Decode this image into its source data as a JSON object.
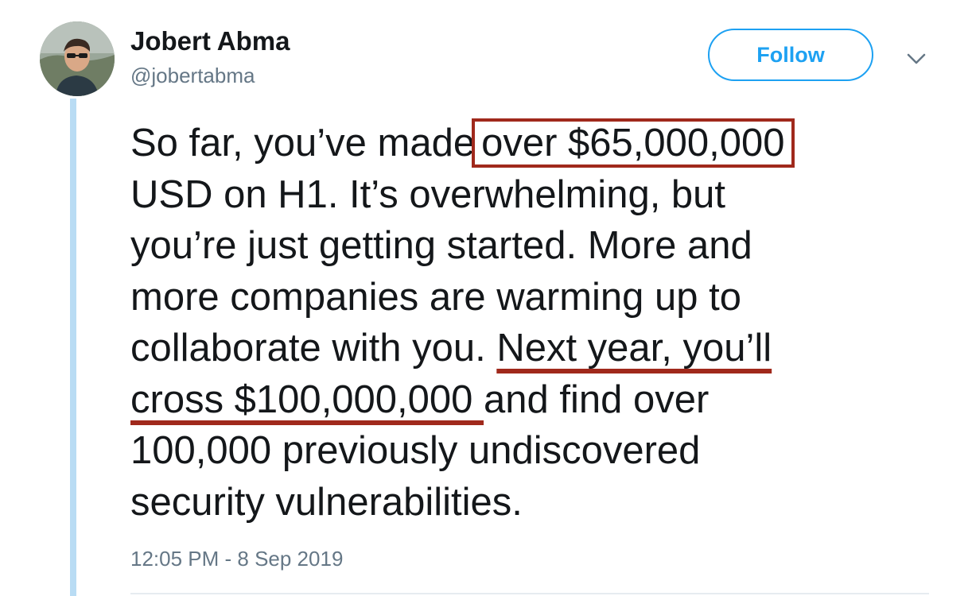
{
  "user": {
    "display_name": "Jobert Abma",
    "handle": "@jobertabma"
  },
  "actions": {
    "follow_label": "Follow",
    "menu_icon": "chevron-down-icon"
  },
  "tweet": {
    "lines": [
      {
        "before": "So far, you’ve made",
        "boxed": "over $65,000,000"
      },
      {
        "text": "USD on H1. It’s overwhelming, but"
      },
      {
        "text": "you’re just getting started. More and"
      },
      {
        "text": "more companies are warming up to"
      },
      {
        "before": "collaborate with you. ",
        "underlined": "Next year, you’ll"
      },
      {
        "underlined": "cross $100,000,000 ",
        "after": "and find over"
      },
      {
        "text": "100,000 previously undiscovered"
      },
      {
        "text": "security vulnerabilities."
      }
    ],
    "timestamp": "12:05 PM - 8 Sep 2019"
  },
  "colors": {
    "accent": "#1da1f2",
    "annotation": "#a0291c",
    "thread_line": "#b9dcf4",
    "secondary_text": "#657786"
  }
}
